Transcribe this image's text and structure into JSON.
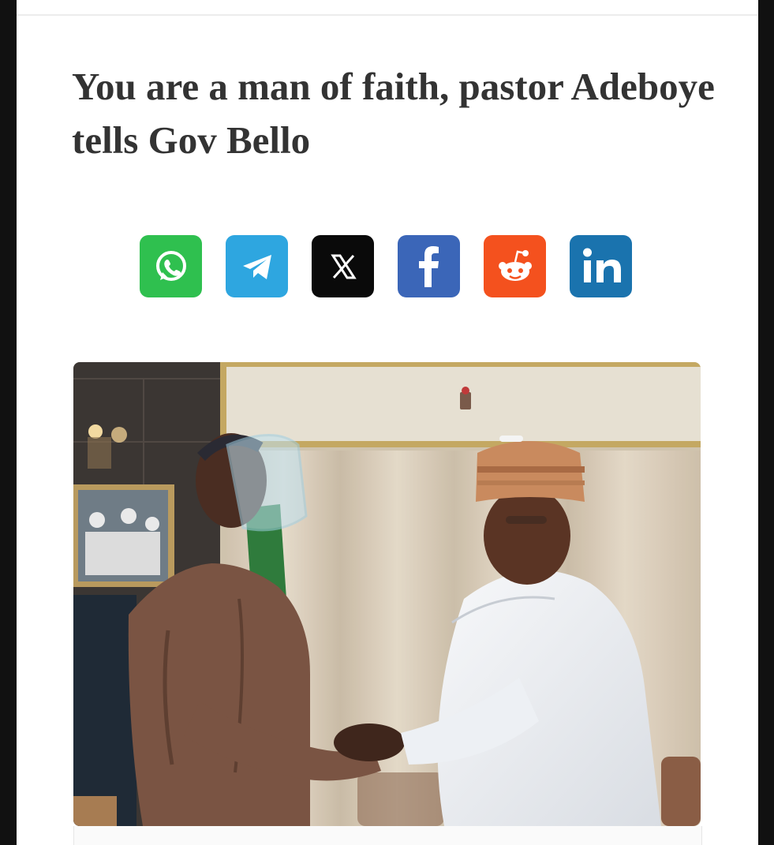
{
  "article": {
    "headline": "You are a man of faith, pastor Adeboye tells Gov Bello"
  },
  "share": {
    "buttons": [
      {
        "name": "whatsapp",
        "icon": "whatsapp-icon",
        "color": "#2fc04f"
      },
      {
        "name": "telegram",
        "icon": "telegram-icon",
        "color": "#2ea6e0"
      },
      {
        "name": "x",
        "icon": "x-icon",
        "color": "#0a0a0a"
      },
      {
        "name": "facebook",
        "icon": "facebook-icon",
        "color": "#3b66b8"
      },
      {
        "name": "reddit",
        "icon": "reddit-icon",
        "color": "#f4511e"
      },
      {
        "name": "linkedin",
        "icon": "linkedin-icon",
        "color": "#1a73ae"
      }
    ]
  },
  "photo": {
    "description_icon": "article-photo"
  }
}
